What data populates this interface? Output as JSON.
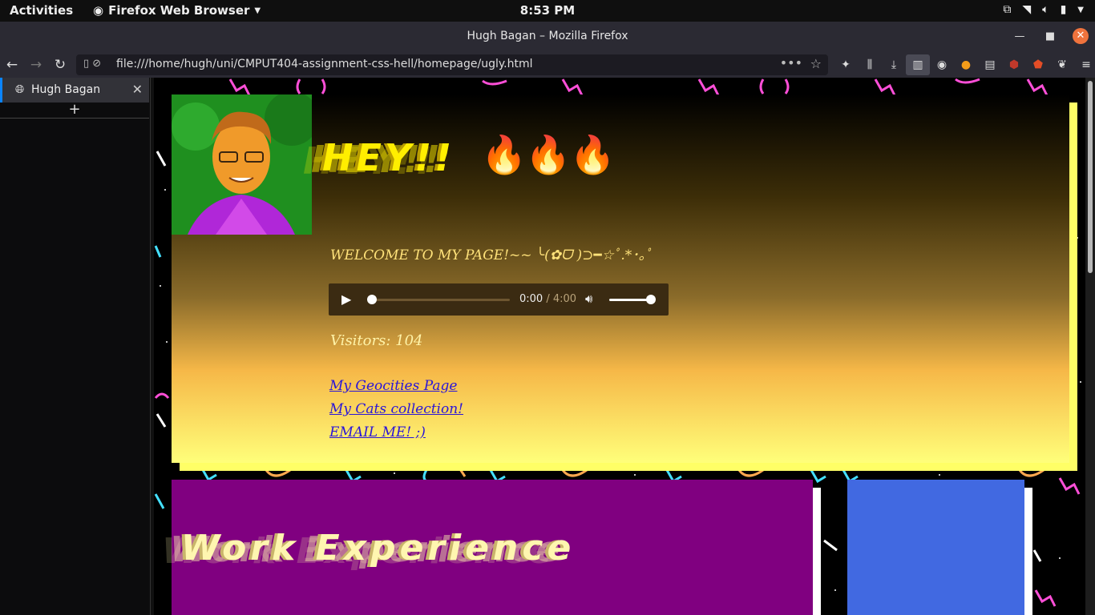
{
  "system": {
    "activities": "Activities",
    "app_name": "Firefox Web Browser",
    "clock": "8:53 PM"
  },
  "window": {
    "title": "Hugh Bagan – Mozilla Firefox"
  },
  "navbar": {
    "url": "file:///home/hugh/uni/CMPUT404-assignment-css-hell/homepage/ugly.html"
  },
  "sidebar": {
    "tabs": [
      {
        "label": "Hugh Bagan"
      }
    ],
    "new_tab_label": "+"
  },
  "page": {
    "hero": {
      "heading": "HEY!!",
      "emoji": "🔥🔥🔥",
      "welcome": "WELCOME TO MY PAGE!~~ ╰(✿ᗜ )⊃━☆ﾟ.*･｡ﾟ",
      "audio": {
        "current_time": "0:00",
        "separator": " / ",
        "duration": "4:00",
        "progress": 0,
        "volume": 1
      },
      "visitors": "Visitors: 104",
      "links": [
        "My Geocities Page",
        "My Cats collection!",
        "EMAIL ME! ;)"
      ]
    },
    "work": {
      "heading": "Work Experience"
    }
  },
  "colors": {
    "hero_glow": "#ffff66",
    "heading_yellow": "#ffee00",
    "work_purple": "#800080",
    "side_blue": "#4169e1",
    "link": "#2a15d8",
    "tab_accent": "#0a84ff"
  }
}
